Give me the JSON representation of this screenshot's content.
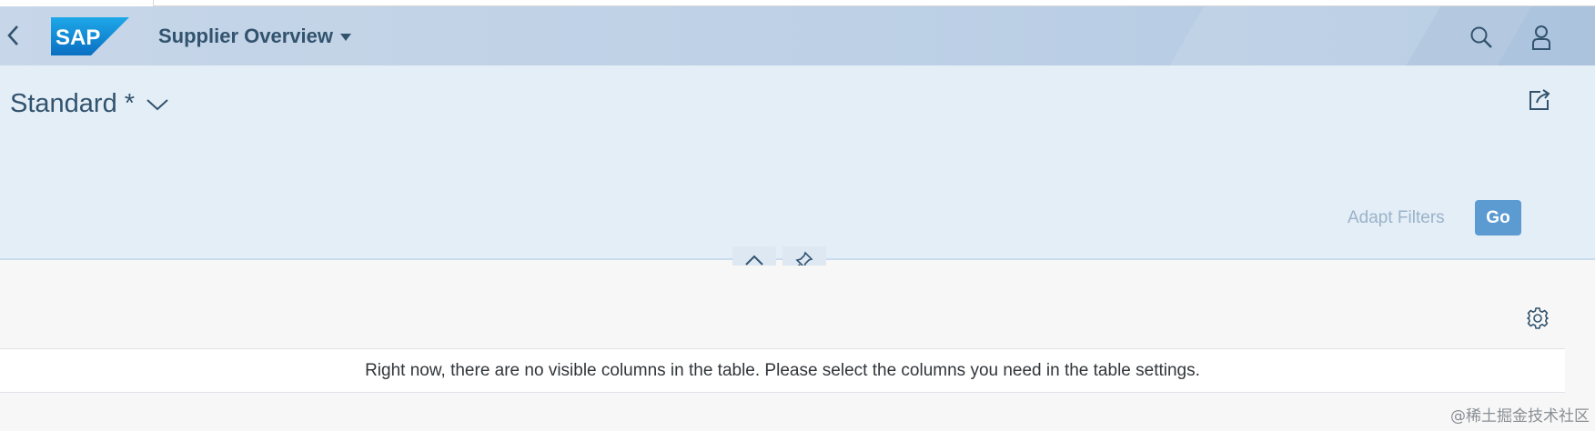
{
  "shell": {
    "logo_text": "SAP",
    "app_title": "Supplier Overview",
    "icons": {
      "back": "back-icon",
      "search": "search-icon",
      "user": "user-icon"
    }
  },
  "header": {
    "variant_name": "Standard *",
    "share_icon": "share-icon"
  },
  "filterbar": {
    "adapt_filters_label": "Adapt Filters",
    "go_label": "Go"
  },
  "header_controls": {
    "collapse_icon": "chevron-up-icon",
    "pin_icon": "pin-icon"
  },
  "table": {
    "settings_icon": "gear-icon",
    "no_data_text": "Right now, there are no visible columns in the table. Please select the columns you need in the table settings."
  },
  "watermark": "@稀土掘金技术社区",
  "colors": {
    "shell_text": "#32536e",
    "go_button": "#5b9bd1",
    "header_bg": "#e4eef7"
  }
}
